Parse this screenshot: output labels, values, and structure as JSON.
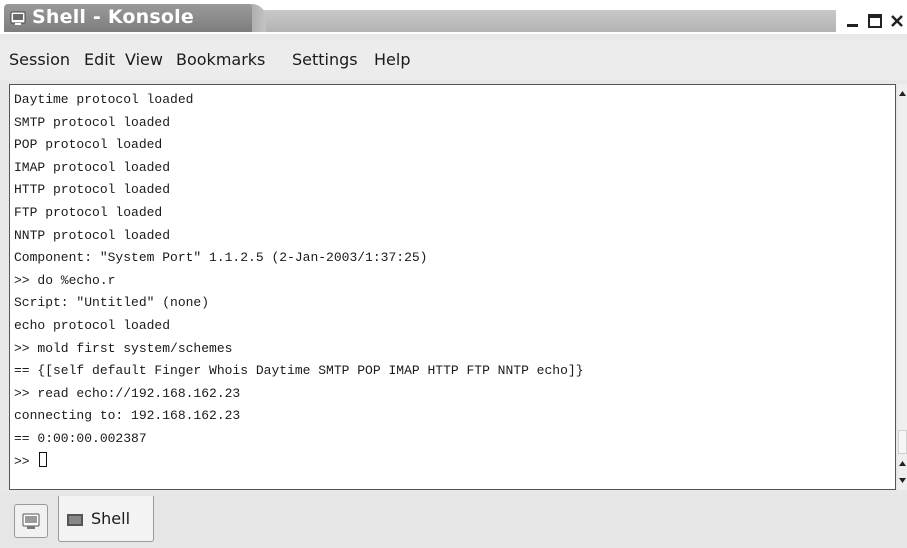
{
  "window": {
    "title": "Shell - Konsole"
  },
  "menubar": {
    "items": [
      "Session",
      "Edit",
      "View",
      "Bookmarks",
      "Settings",
      "Help"
    ]
  },
  "terminal": {
    "lines": [
      "Daytime protocol loaded",
      "SMTP protocol loaded",
      "POP protocol loaded",
      "IMAP protocol loaded",
      "HTTP protocol loaded",
      "FTP protocol loaded",
      "NNTP protocol loaded",
      "Component: \"System Port\" 1.1.2.5 (2-Jan-2003/1:37:25)",
      ">> do %echo.r",
      "Script: \"Untitled\" (none)",
      "echo protocol loaded",
      ">> mold first system/schemes",
      "== {[self default Finger Whois Daytime SMTP POP IMAP HTTP FTP NNTP echo]}",
      ">> read echo://192.168.162.23",
      "connecting to: 192.168.162.23",
      "== 0:00:00.002387"
    ],
    "prompt": ">> "
  },
  "tabbar": {
    "tabs": [
      {
        "label": "Shell",
        "icon": "terminal-icon"
      }
    ],
    "new_tab_icon": "new-session-icon"
  },
  "icons": {
    "app": "konsole-icon",
    "minimize": "minimize-icon",
    "maximize": "maximize-icon",
    "close": "close-icon"
  },
  "colors": {
    "title_active": "#8a8a8a",
    "title_text": "#ffffff",
    "terminal_bg": "#ffffff",
    "terminal_fg": "#1a1a1a"
  }
}
